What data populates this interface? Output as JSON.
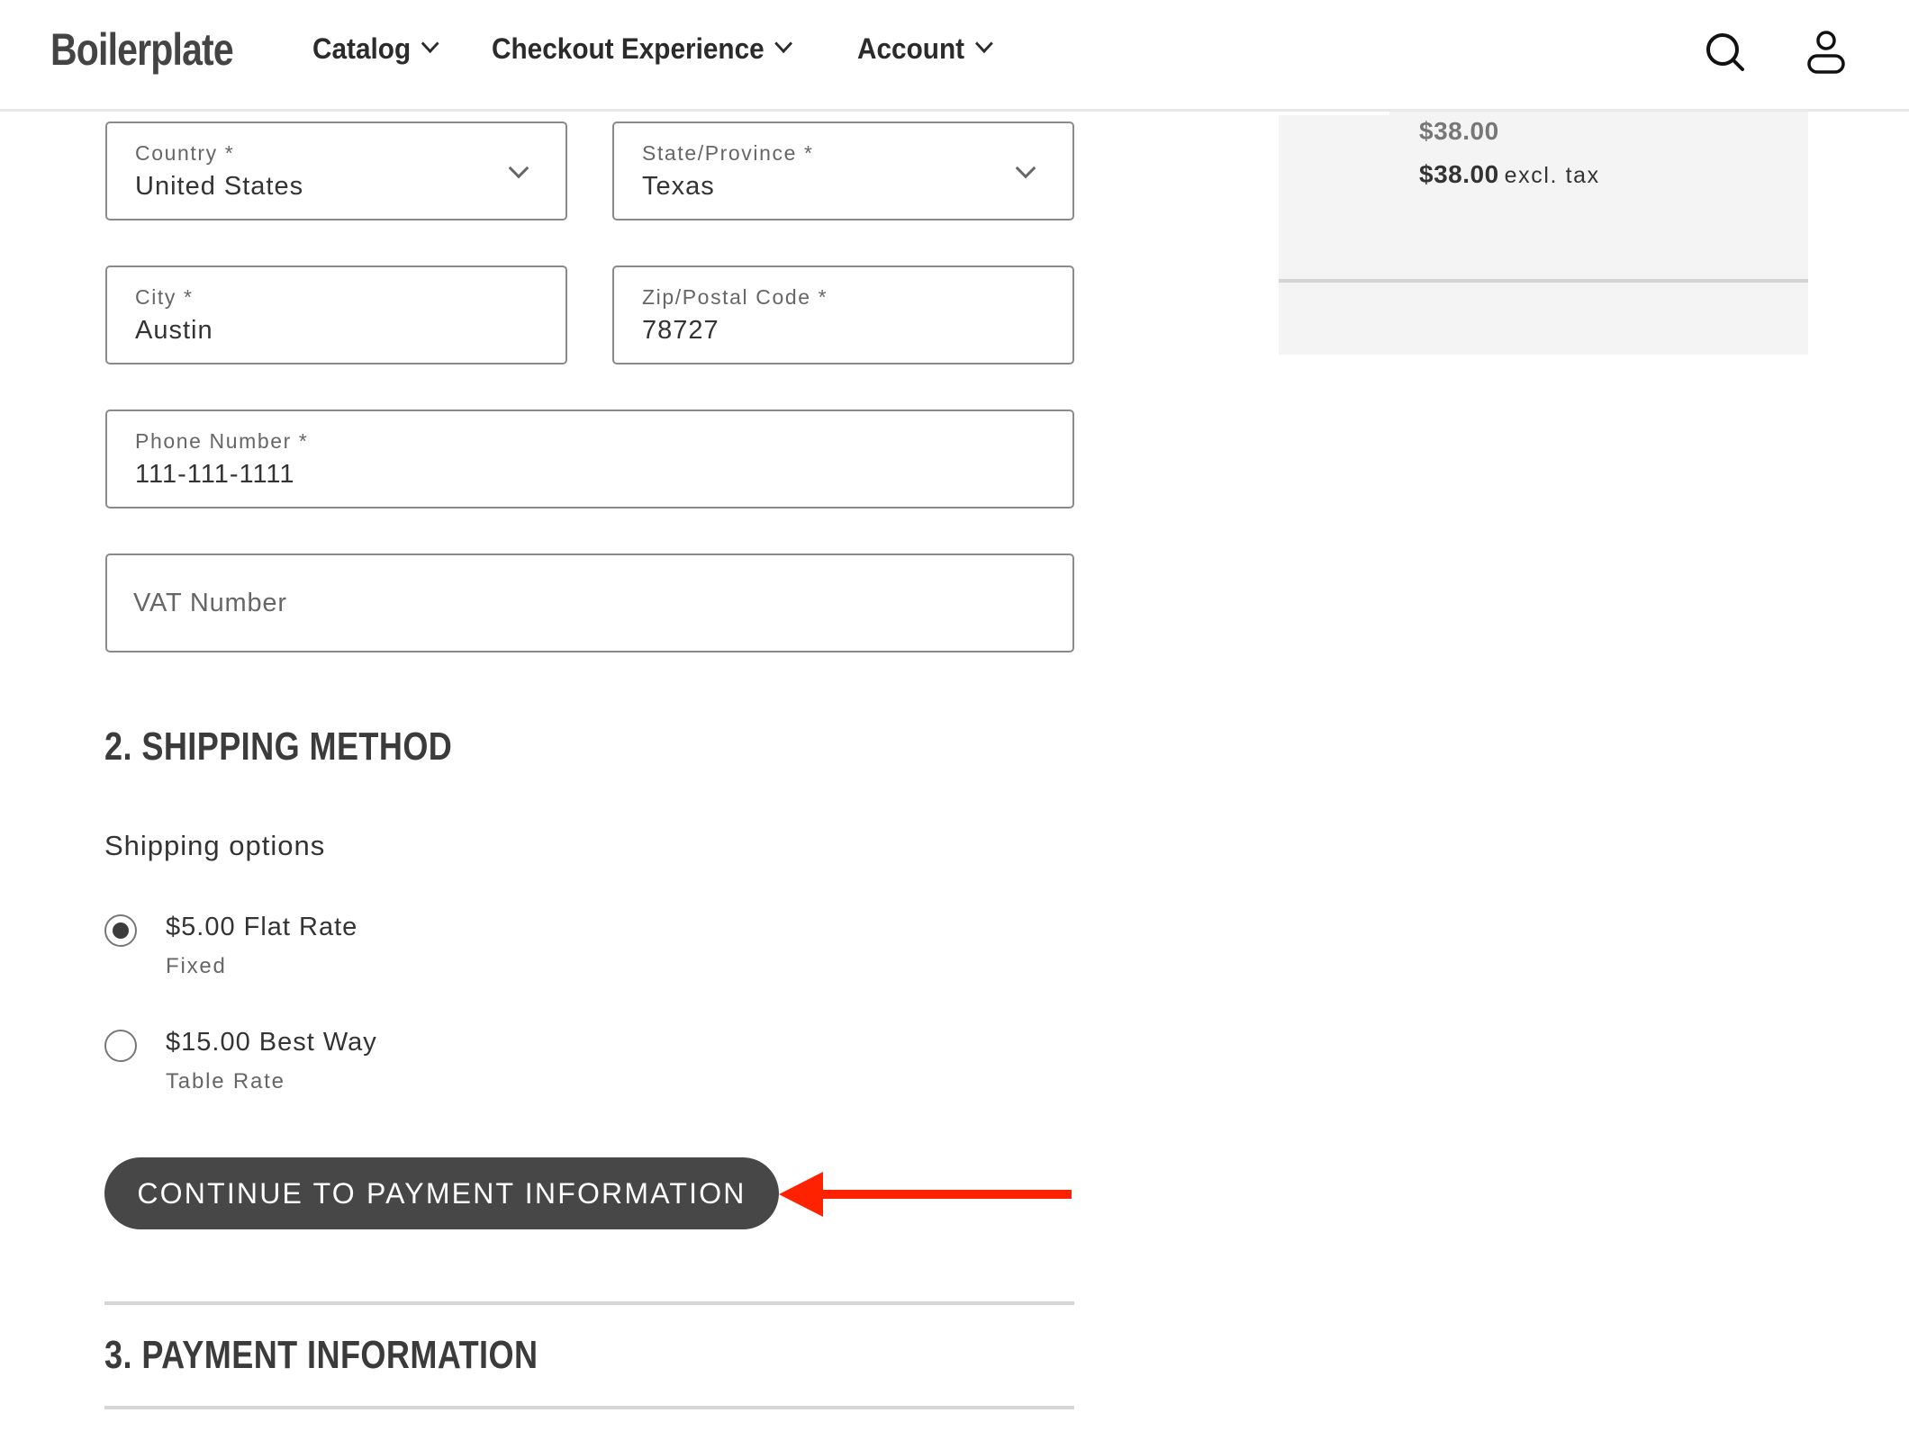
{
  "header": {
    "logo": "Boilerplate",
    "nav": [
      {
        "label": "Catalog"
      },
      {
        "label": "Checkout Experience"
      },
      {
        "label": "Account"
      }
    ],
    "icons": [
      "search-icon",
      "user-account-icon"
    ]
  },
  "address_form": {
    "country": {
      "label": "Country *",
      "value": "United States"
    },
    "state": {
      "label": "State/Province *",
      "value": "Texas"
    },
    "city": {
      "label": "City *",
      "value": "Austin"
    },
    "zip": {
      "label": "Zip/Postal Code *",
      "value": "78727"
    },
    "phone": {
      "label": "Phone Number *",
      "value": "111-111-1111"
    },
    "vat": {
      "placeholder": "VAT Number",
      "value": ""
    }
  },
  "shipping": {
    "heading": "2. SHIPPING METHOD",
    "options_label": "Shipping options",
    "options": [
      {
        "label": "$5.00 Flat Rate",
        "sublabel": "Fixed",
        "selected": true
      },
      {
        "label": "$15.00 Best Way",
        "sublabel": "Table Rate",
        "selected": false
      }
    ],
    "continue_button": "CONTINUE TO PAYMENT INFORMATION"
  },
  "payment": {
    "heading": "3. PAYMENT INFORMATION"
  },
  "summary": {
    "price": "$38.00",
    "price_excl": "$38.00",
    "excl_label": "excl. tax"
  },
  "annotation": {
    "arrow_color": "#ff2200",
    "points_to": "continue-to-payment-button"
  }
}
